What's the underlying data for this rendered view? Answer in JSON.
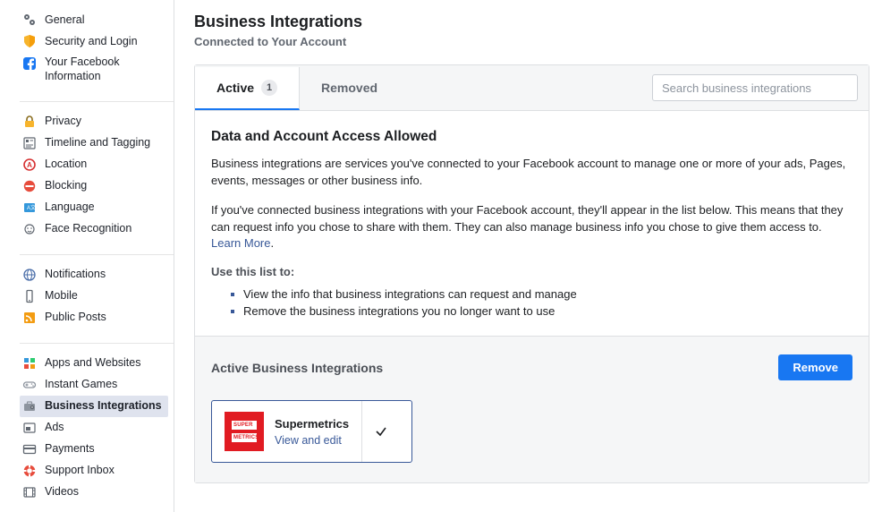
{
  "sidebar": {
    "items": [
      {
        "id": "general",
        "label": "General",
        "icon": "gears-icon"
      },
      {
        "id": "security",
        "label": "Security and Login",
        "icon": "shield-icon"
      },
      {
        "id": "yourinfo",
        "label": "Your Facebook Information",
        "icon": "facebook-badge-icon"
      },
      {
        "id": "privacy",
        "label": "Privacy",
        "icon": "lock-icon"
      },
      {
        "id": "timeline",
        "label": "Timeline and Tagging",
        "icon": "tag-icon"
      },
      {
        "id": "location",
        "label": "Location",
        "icon": "location-icon"
      },
      {
        "id": "blocking",
        "label": "Blocking",
        "icon": "block-icon"
      },
      {
        "id": "language",
        "label": "Language",
        "icon": "language-icon"
      },
      {
        "id": "facerec",
        "label": "Face Recognition",
        "icon": "face-icon"
      },
      {
        "id": "notifications",
        "label": "Notifications",
        "icon": "globe-icon"
      },
      {
        "id": "mobile",
        "label": "Mobile",
        "icon": "mobile-icon"
      },
      {
        "id": "publicposts",
        "label": "Public Posts",
        "icon": "feed-icon"
      },
      {
        "id": "apps",
        "label": "Apps and Websites",
        "icon": "apps-icon"
      },
      {
        "id": "games",
        "label": "Instant Games",
        "icon": "games-icon"
      },
      {
        "id": "bizint",
        "label": "Business Integrations",
        "icon": "briefcase-gear-icon"
      },
      {
        "id": "ads",
        "label": "Ads",
        "icon": "ad-icon"
      },
      {
        "id": "payments",
        "label": "Payments",
        "icon": "card-icon"
      },
      {
        "id": "support",
        "label": "Support Inbox",
        "icon": "lifesaver-icon"
      },
      {
        "id": "videos",
        "label": "Videos",
        "icon": "film-icon"
      }
    ]
  },
  "page": {
    "title": "Business Integrations",
    "subtitle": "Connected to Your Account"
  },
  "tabs": {
    "active_label": "Active",
    "active_count": "1",
    "removed_label": "Removed"
  },
  "search": {
    "placeholder": "Search business integrations"
  },
  "content": {
    "heading": "Data and Account Access Allowed",
    "para1": "Business integrations are services you've connected to your Facebook account to manage one or more of your ads, Pages, events, messages or other business info.",
    "para2_a": "If you've connected business integrations with your Facebook account, they'll appear in the list below. This means that they can request info you chose to share with them. They can also manage business info you chose to give them access to. ",
    "learn_more": "Learn More",
    "period": ".",
    "list_title": "Use this list to:",
    "bullets": [
      "View the info that business integrations can request and manage",
      "Remove the business integrations you no longer want to use"
    ]
  },
  "lower": {
    "title": "Active Business Integrations",
    "remove_label": "Remove",
    "app": {
      "name": "Supermetrics",
      "action": "View and edit",
      "logo_line1": "SUPER",
      "logo_line2": "METRICS",
      "checked": true
    }
  },
  "colors": {
    "accent": "#1877f2",
    "link": "#385898",
    "danger": "#e11b22"
  }
}
